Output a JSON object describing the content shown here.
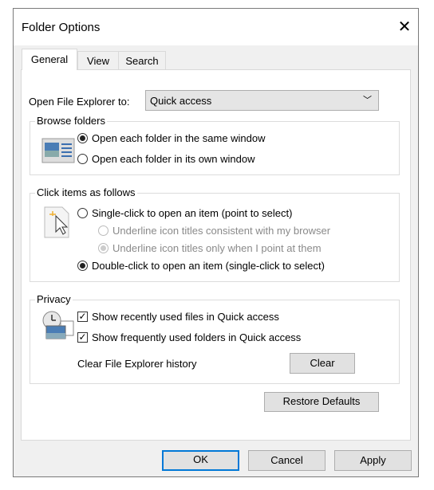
{
  "window": {
    "title": "Folder Options",
    "close_icon": "close-icon"
  },
  "tabs": [
    {
      "label": "General",
      "active": true
    },
    {
      "label": "View"
    },
    {
      "label": "Search"
    }
  ],
  "open_to": {
    "label": "Open File Explorer to:",
    "value": "Quick access"
  },
  "browse": {
    "title": "Browse folders",
    "options": [
      {
        "label": "Open each folder in the same window",
        "selected": true
      },
      {
        "label": "Open each folder in its own window",
        "selected": false
      }
    ]
  },
  "click": {
    "title": "Click items as follows",
    "single": "Single-click to open an item (point to select)",
    "underline_browser": "Underline icon titles consistent with my browser",
    "underline_point": "Underline icon titles only when I point at them",
    "double": "Double-click to open an item (single-click to select)"
  },
  "privacy": {
    "title": "Privacy",
    "recent_files": "Show recently used files in Quick access",
    "frequent_folders": "Show frequently used folders in Quick access",
    "clear_label": "Clear File Explorer history",
    "clear_button": "Clear"
  },
  "restore_defaults": "Restore Defaults",
  "buttons": {
    "ok": "OK",
    "cancel": "Cancel",
    "apply": "Apply"
  },
  "colors": {
    "accent": "#0078d7"
  }
}
